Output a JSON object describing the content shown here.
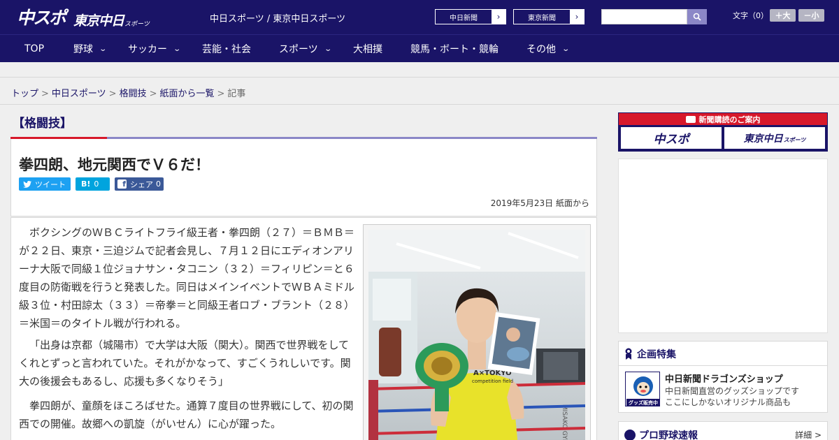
{
  "header": {
    "logo_main": "中スポ",
    "logo_sub": "東京中日",
    "logo_small": "スポーツ",
    "site_title": "中日スポーツ / 東京中日スポーツ",
    "ext_links": [
      {
        "label": "中日新聞",
        "arrow": "›"
      },
      {
        "label": "東京新聞",
        "arrow": "›"
      }
    ],
    "search_placeholder": "",
    "font_size_label": "文字（0）",
    "font_larger": "＋大",
    "font_smaller": "－小",
    "bg_color": "#1a1467"
  },
  "nav": {
    "items": [
      {
        "label": "TOP",
        "dropdown": false
      },
      {
        "label": "野球",
        "dropdown": true
      },
      {
        "label": "サッカー",
        "dropdown": true
      },
      {
        "label": "芸能・社会",
        "dropdown": false
      },
      {
        "label": "スポーツ",
        "dropdown": true
      },
      {
        "label": "大相撲",
        "dropdown": false
      },
      {
        "label": "競馬・ボート・競輪",
        "dropdown": false
      },
      {
        "label": "その他",
        "dropdown": true
      }
    ],
    "chevron": "⌄"
  },
  "breadcrumb": {
    "items": [
      "トップ",
      "中日スポーツ",
      "格闘技",
      "紙面から一覧"
    ],
    "current": "記事",
    "sep": ">"
  },
  "article": {
    "category": "【格闘技】",
    "headline": "拳四朗、地元関西でＶ６だ！",
    "share": {
      "tweet": "ツイート",
      "hatena_count": "0",
      "facebook_label": "シェア",
      "facebook_count": "0"
    },
    "date": "2019年5月23日 紙面から",
    "paragraphs": [
      "ボクシングのＷＢＣライトフライ級王者・拳四朗（２７）＝ＢＭＢ＝が２２日、東京・三迫ジムで記者会見し、７月１２日にエディオンアリーナ大阪で同級１位ジョナサン・タコニン（３２）＝フィリピン＝と６度目の防衛戦を行うと発表した。同日はメインイベントでＷＢＡミドル級３位・村田諒太（３３）＝帝拳＝と同級王者ロブ・ブラント（２８）＝米国＝のタイトル戦が行われる。",
      "「出身は京都（城陽市）で大学は大阪（関大）。関西で世界戦をしてくれとずっと言われていた。それがかなって、すごくうれしいです。関大の後援会もあるし、応援も多くなりそう」",
      "拳四朗が、童顔をほころばせた。通算７度目の世界戦にして、初の関西での開催。故郷への凱旋（がいせん）に心が躍った。"
    ]
  },
  "sidebar": {
    "subscribe_head": "新聞購読のご案内",
    "subscribe_a": "中スポ",
    "subscribe_b": "東京中日",
    "subscribe_b_small": "スポーツ",
    "feature_title": "企画特集",
    "shop_title": "中日新聞ドラゴンズショップ",
    "shop_desc_1": "中日新聞直営のグッズショップです",
    "shop_desc_2": "ここにしかないオリジナル商品も",
    "shop_badge": "グッズ販売中",
    "baseball_title": "プロ野球速報",
    "baseball_more": "詳細 >"
  },
  "colors": {
    "brand_navy": "#1a1467",
    "accent_red": "#d7182a",
    "twitter": "#1da1f2",
    "hatena": "#00a4de",
    "facebook": "#3b5998"
  }
}
